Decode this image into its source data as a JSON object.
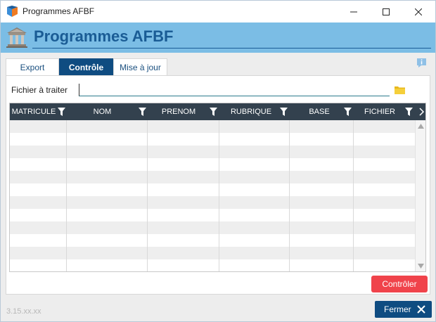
{
  "window": {
    "title": "Programmes AFBF",
    "controls": [
      "minimize-icon",
      "maximize-icon",
      "close-icon"
    ]
  },
  "header": {
    "title": "Programmes AFBF",
    "icon": "bank-building-icon"
  },
  "info_icon": "info-comment-icon",
  "tabs": [
    {
      "label": "Export",
      "active": false
    },
    {
      "label": "Contrôle",
      "active": true
    },
    {
      "label": "Mise à jour",
      "active": false
    }
  ],
  "file": {
    "label": "Fichier à traiter",
    "value": "",
    "browse_icon": "folder-icon"
  },
  "grid": {
    "columns": [
      {
        "label": "MATRICULE",
        "filter_icon": "filter-icon"
      },
      {
        "label": "NOM",
        "filter_icon": "filter-icon"
      },
      {
        "label": "PRENOM",
        "filter_icon": "filter-icon"
      },
      {
        "label": "RUBRIQUE",
        "filter_icon": "filter-icon"
      },
      {
        "label": "BASE",
        "filter_icon": "filter-icon"
      },
      {
        "label": "FICHIER",
        "filter_icon": "filter-icon"
      }
    ],
    "rows": []
  },
  "actions": {
    "controler_label": "Contrôler",
    "fermer_label": "Fermer"
  },
  "footer": {
    "version": "3.15.xx.xx"
  },
  "colors": {
    "header_band": "#7bbde5",
    "title_blue": "#1a5c95",
    "active_tab": "#0f4c81",
    "grid_header": "#33414e",
    "controler_button": "#f0434b",
    "fermer_button": "#0f4c81"
  }
}
